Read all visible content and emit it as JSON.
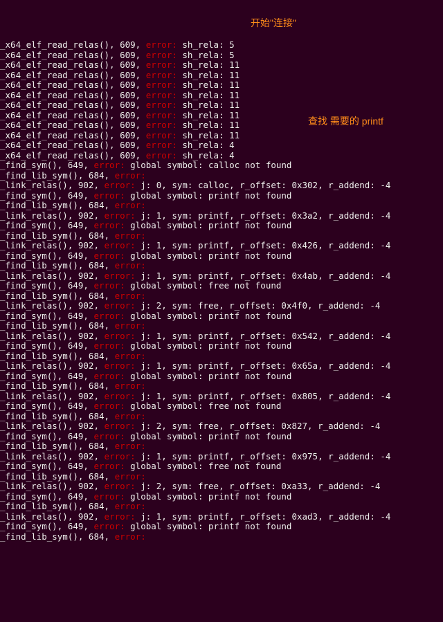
{
  "annotations": {
    "a1": "开始\"连接\"",
    "a2": "查找 需要的 printf"
  },
  "lines": [
    {
      "fn": "_x64_elf_read_relas(), 609, ",
      "msg": " sh_rela: 5"
    },
    {
      "fn": "_x64_elf_read_relas(), 609, ",
      "msg": " sh_rela: 5"
    },
    {
      "fn": "_x64_elf_read_relas(), 609, ",
      "msg": " sh_rela: 11"
    },
    {
      "fn": "_x64_elf_read_relas(), 609, ",
      "msg": " sh_rela: 11"
    },
    {
      "fn": "_x64_elf_read_relas(), 609, ",
      "msg": " sh_rela: 11"
    },
    {
      "fn": "_x64_elf_read_relas(), 609, ",
      "msg": " sh_rela: 11"
    },
    {
      "fn": "_x64_elf_read_relas(), 609, ",
      "msg": " sh_rela: 11"
    },
    {
      "fn": "_x64_elf_read_relas(), 609, ",
      "msg": " sh_rela: 11"
    },
    {
      "fn": "_x64_elf_read_relas(), 609, ",
      "msg": " sh_rela: 11"
    },
    {
      "fn": "_x64_elf_read_relas(), 609, ",
      "msg": " sh_rela: 11"
    },
    {
      "fn": "_x64_elf_read_relas(), 609, ",
      "msg": " sh_rela: 4"
    },
    {
      "fn": "_x64_elf_read_relas(), 609, ",
      "msg": " sh_rela: 4"
    },
    {
      "fn": "_find_sym(), 649, ",
      "msg": " global symbol: calloc not found"
    },
    {
      "fn": "_find_lib_sym(), 684, ",
      "msg": ""
    },
    {
      "fn": "_link_relas(), 902, ",
      "msg": " j: 0, sym: calloc, r_offset: 0x302, r_addend: -4"
    },
    {
      "fn": "_find_sym(), 649, ",
      "msg": " global symbol: printf not found"
    },
    {
      "fn": "_find_lib_sym(), 684, ",
      "msg": ""
    },
    {
      "fn": "_link_relas(), 902, ",
      "msg": " j: 1, sym: printf, r_offset: 0x3a2, r_addend: -4"
    },
    {
      "fn": "_find_sym(), 649, ",
      "msg": " global symbol: printf not found"
    },
    {
      "fn": "_find_lib_sym(), 684, ",
      "msg": ""
    },
    {
      "fn": "_link_relas(), 902, ",
      "msg": " j: 1, sym: printf, r_offset: 0x426, r_addend: -4"
    },
    {
      "fn": "_find_sym(), 649, ",
      "msg": " global symbol: printf not found"
    },
    {
      "fn": "_find_lib_sym(), 684, ",
      "msg": ""
    },
    {
      "fn": "_link_relas(), 902, ",
      "msg": " j: 1, sym: printf, r_offset: 0x4ab, r_addend: -4"
    },
    {
      "fn": "_find_sym(), 649, ",
      "msg": " global symbol: free not found"
    },
    {
      "fn": "_find_lib_sym(), 684, ",
      "msg": ""
    },
    {
      "fn": "_link_relas(), 902, ",
      "msg": " j: 2, sym: free, r_offset: 0x4f0, r_addend: -4"
    },
    {
      "fn": "_find_sym(), 649, ",
      "msg": " global symbol: printf not found"
    },
    {
      "fn": "_find_lib_sym(), 684, ",
      "msg": ""
    },
    {
      "fn": "_link_relas(), 902, ",
      "msg": " j: 1, sym: printf, r_offset: 0x542, r_addend: -4"
    },
    {
      "fn": "_find_sym(), 649, ",
      "msg": " global symbol: printf not found"
    },
    {
      "fn": "_find_lib_sym(), 684, ",
      "msg": ""
    },
    {
      "fn": "_link_relas(), 902, ",
      "msg": " j: 1, sym: printf, r_offset: 0x65a, r_addend: -4"
    },
    {
      "fn": "_find_sym(), 649, ",
      "msg": " global symbol: printf not found"
    },
    {
      "fn": "_find_lib_sym(), 684, ",
      "msg": ""
    },
    {
      "fn": "_link_relas(), 902, ",
      "msg": " j: 1, sym: printf, r_offset: 0x805, r_addend: -4"
    },
    {
      "fn": "_find_sym(), 649, ",
      "msg": " global symbol: free not found"
    },
    {
      "fn": "_find_lib_sym(), 684, ",
      "msg": ""
    },
    {
      "fn": "_link_relas(), 902, ",
      "msg": " j: 2, sym: free, r_offset: 0x827, r_addend: -4"
    },
    {
      "fn": "_find_sym(), 649, ",
      "msg": " global symbol: printf not found"
    },
    {
      "fn": "_find_lib_sym(), 684, ",
      "msg": ""
    },
    {
      "fn": "_link_relas(), 902, ",
      "msg": " j: 1, sym: printf, r_offset: 0x975, r_addend: -4"
    },
    {
      "fn": "_find_sym(), 649, ",
      "msg": " global symbol: free not found"
    },
    {
      "fn": "_find_lib_sym(), 684, ",
      "msg": ""
    },
    {
      "fn": "_link_relas(), 902, ",
      "msg": " j: 2, sym: free, r_offset: 0xa33, r_addend: -4"
    },
    {
      "fn": "_find_sym(), 649, ",
      "msg": " global symbol: printf not found"
    },
    {
      "fn": "_find_lib_sym(), 684, ",
      "msg": ""
    },
    {
      "fn": "_link_relas(), 902, ",
      "msg": " j: 1, sym: printf, r_offset: 0xad3, r_addend: -4"
    },
    {
      "fn": "_find_sym(), 649, ",
      "msg": " global symbol: printf not found"
    },
    {
      "fn": "_find_lib_sym(), 684, ",
      "msg": ""
    }
  ],
  "err_label": "error:"
}
